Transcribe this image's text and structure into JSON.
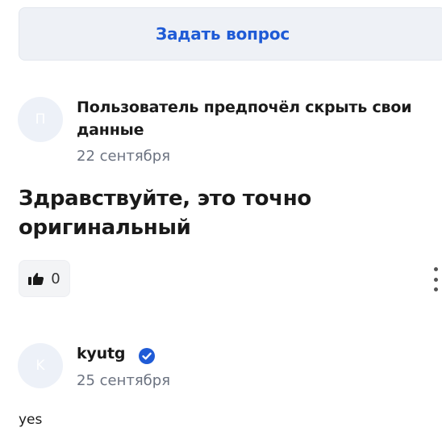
{
  "ask": {
    "label": "Задать вопрос"
  },
  "question": {
    "author": {
      "initial": "П",
      "name": "Пользователь предпочёл скрыть свои данные"
    },
    "date": "22 сентября",
    "title": "Здравствуйте, это точно оригинальный",
    "likes": {
      "icon": "thumbs-up-icon",
      "count": "0"
    },
    "menu_icon": "more-vertical-icon"
  },
  "answer": {
    "author": {
      "initial": "K",
      "name": "kyutg",
      "badge_icon": "verified-check-icon"
    },
    "date": "25 сентября",
    "text": "yes"
  },
  "colors": {
    "accent": "#1f5bd6",
    "button_bg": "#eef1f6",
    "avatar_bg": "#edf1f8",
    "muted": "#6b7280"
  }
}
